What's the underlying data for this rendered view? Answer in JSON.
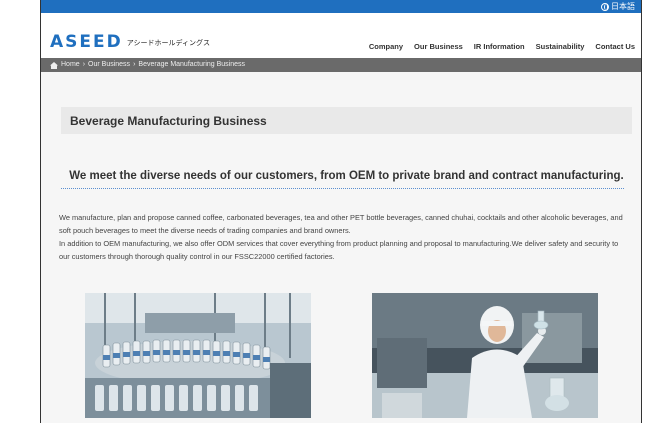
{
  "site": {
    "language_link": "日本語",
    "logo_mark": "ASEED",
    "logo_sub": "アシードホールディングス"
  },
  "nav": {
    "items": [
      "Company",
      "Our Business",
      "IR Information",
      "Sustainability",
      "Contact Us"
    ]
  },
  "breadcrumb": {
    "home": "Home",
    "separator1": "›",
    "level1": "Our Business",
    "separator2": "›",
    "current": "Beverage Manufacturing Business"
  },
  "page": {
    "title": "Beverage Manufacturing Business",
    "lead": "We meet the diverse needs of our customers, from OEM to private brand and contract manufacturing.",
    "paragraph1": "We manufacture, plan and propose canned coffee, carbonated beverages, tea and other PET bottle beverages, canned chuhai, cocktails and other alcoholic beverages, and soft pouch beverages to meet the diverse needs of trading companies and brand owners.",
    "paragraph2": "In addition to OEM manufacturing, we also offer ODM services that cover everything from product planning and proposal to manufacturing.We deliver safety and security to our customers through thorough quality control in our FSSC22000 certified factories."
  },
  "colors": {
    "brand_blue": "#1f6fbf",
    "breadcrumb_bg": "#6a6a6a",
    "title_box_bg": "#e9e9e9",
    "content_bg": "#f6f6f6"
  }
}
